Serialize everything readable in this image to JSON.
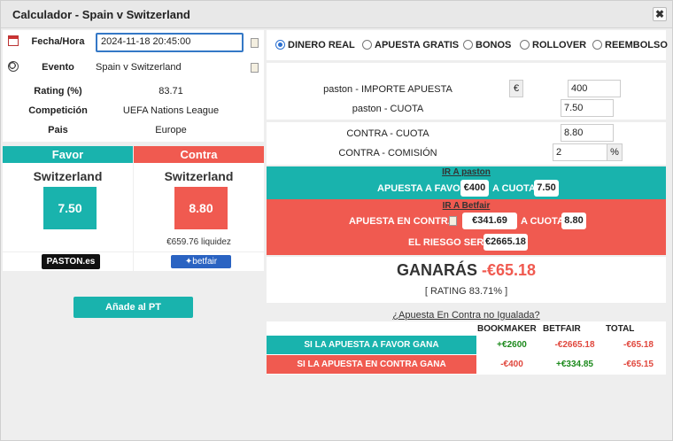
{
  "window": {
    "title": "Calculador - Spain v Switzerland",
    "close_symbol": "✖"
  },
  "info": {
    "fecha_label": "Fecha/Hora",
    "fecha_value": "2024-11-18 20:45:00",
    "evento_label": "Evento",
    "evento_value": "Spain v Switzerland",
    "rating_label": "Rating (%)",
    "rating_value": "83.71",
    "competicion_label": "Competición",
    "competicion_value": "UEFA Nations League",
    "pais_label": "Pais",
    "pais_value": "Europe"
  },
  "favor": {
    "header": "Favor",
    "team": "Switzerland",
    "odds": "7.50",
    "color": "#19b3ad",
    "bookmaker_logo": "PASTON.es"
  },
  "contra": {
    "header": "Contra",
    "team": "Switzerland",
    "odds": "8.80",
    "liquidity": "€659.76 liquidez",
    "color": "#f05a50",
    "exchange_logo": "✦betfair"
  },
  "add_button": "Añade al PT",
  "bet_types": [
    {
      "label": "DINERO REAL",
      "selected": true
    },
    {
      "label": "APUESTA GRATIS",
      "selected": false
    },
    {
      "label": "BONOS",
      "selected": false
    },
    {
      "label": "ROLLOVER",
      "selected": false
    },
    {
      "label": "REEMBOLSO",
      "selected": false
    }
  ],
  "inputs": {
    "importe_label": "paston - IMPORTE APUESTA",
    "importe_currency": "€",
    "importe_value": "400",
    "cuota_label": "paston - CUOTA",
    "cuota_value": "7.50",
    "contra_cuota_label": "CONTRA - CUOTA",
    "contra_cuota_value": "8.80",
    "comision_label": "CONTRA - COMISIÓN",
    "comision_value": "2",
    "comision_unit": "%"
  },
  "instructions": {
    "ir_paston": "IR A paston",
    "apuesta_favor_text": "APUESTA A FAVOR",
    "apuesta_favor_amount": "€400",
    "a_cuota_text": "A CUOTA",
    "favor_cuota": "7.50",
    "ir_betfair": "IR A Betfair",
    "apuesta_contra_text": "APUESTA EN CONTRA",
    "apuesta_contra_amount": "€341.69",
    "contra_a_cuota_text": "A CUOTA",
    "contra_cuota": "8.80",
    "riesgo_text": "EL RIESGO SERÁ",
    "riesgo_amount": "€2665.18"
  },
  "result": {
    "ganaras_label": "GANARÁS",
    "ganaras_value": "-€65.18",
    "rating_text": "[ RATING 83.71% ]"
  },
  "unmatched_link": "¿Apuesta En Contra no Igualada?",
  "outcome_table": {
    "headers": [
      "BOOKMAKER",
      "BETFAIR",
      "TOTAL"
    ],
    "rows": [
      {
        "label": "SI LA APUESTA A FAVOR GANA",
        "bookmaker": "+€2600",
        "betfair": "-€2665.18",
        "total": "-€65.18"
      },
      {
        "label": "SI LA APUESTA EN CONTRA GANA",
        "bookmaker": "-€400",
        "betfair": "+€334.85",
        "total": "-€65.15"
      }
    ]
  }
}
